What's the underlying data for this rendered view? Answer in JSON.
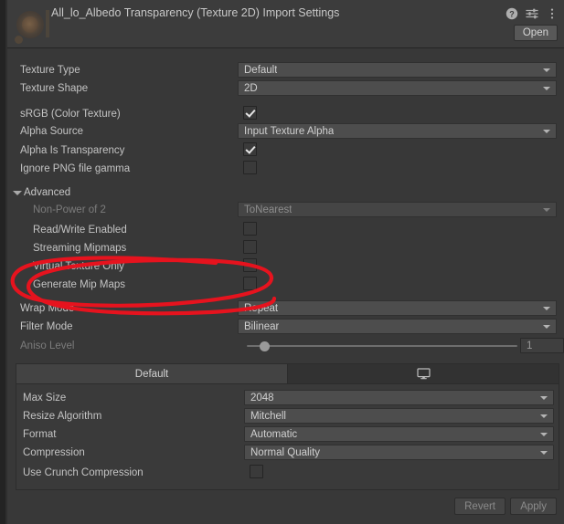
{
  "header": {
    "title": "All_lo_Albedo Transparency (Texture 2D) Import Settings",
    "open_label": "Open",
    "icons": {
      "help": "help-icon",
      "preset": "preset-settings-icon",
      "menu": "more-menu-icon"
    },
    "thumbnail": "texture-thumbnail"
  },
  "main_rows": [
    {
      "label": "Texture Type",
      "type": "dropdown",
      "value": "Default",
      "disabled": false
    },
    {
      "label": "Texture Shape",
      "type": "dropdown",
      "value": "2D",
      "disabled": false
    },
    {
      "label": "sRGB (Color Texture)",
      "type": "checkbox",
      "checked": true,
      "disabled": false
    },
    {
      "label": "Alpha Source",
      "type": "dropdown",
      "value": "Input Texture Alpha",
      "disabled": false
    },
    {
      "label": "Alpha Is Transparency",
      "type": "checkbox",
      "checked": true,
      "disabled": false
    },
    {
      "label": "Ignore PNG file gamma",
      "type": "checkbox",
      "checked": false,
      "disabled": false
    }
  ],
  "advanced": {
    "label": "Advanced",
    "expanded": true,
    "rows": [
      {
        "label": "Non-Power of 2",
        "type": "dropdown",
        "value": "ToNearest",
        "disabled": true
      },
      {
        "label": "Read/Write Enabled",
        "type": "checkbox",
        "checked": false,
        "disabled": false
      },
      {
        "label": "Streaming Mipmaps",
        "type": "checkbox",
        "checked": false,
        "disabled": false
      },
      {
        "label": "Virtual Texture Only",
        "type": "checkbox",
        "checked": false,
        "disabled": false
      },
      {
        "label": "Generate Mip Maps",
        "type": "checkbox",
        "checked": false,
        "disabled": false
      }
    ]
  },
  "sampling_rows": [
    {
      "label": "Wrap Mode",
      "type": "dropdown",
      "value": "Repeat",
      "disabled": false
    },
    {
      "label": "Filter Mode",
      "type": "dropdown",
      "value": "Bilinear",
      "disabled": false
    }
  ],
  "aniso": {
    "label": "Aniso Level",
    "value": "1",
    "disabled": true,
    "slider_position_pct": 5
  },
  "platform": {
    "tabs": [
      {
        "label": "Default",
        "icon": null,
        "active": true
      },
      {
        "label": "",
        "icon": "standalone-monitor-icon",
        "active": false
      }
    ],
    "rows": [
      {
        "label": "Max Size",
        "type": "dropdown",
        "value": "2048"
      },
      {
        "label": "Resize Algorithm",
        "type": "dropdown",
        "value": "Mitchell"
      },
      {
        "label": "Format",
        "type": "dropdown",
        "value": "Automatic"
      },
      {
        "label": "Compression",
        "type": "dropdown",
        "value": "Normal Quality"
      },
      {
        "label": "Use Crunch Compression",
        "type": "checkbox",
        "checked": false
      }
    ]
  },
  "footer": {
    "revert_label": "Revert",
    "apply_label": "Apply"
  },
  "annotation": {
    "kind": "hand-drawn-red-ellipse",
    "target_label": "Generate Mip Maps",
    "color": "#e6131e"
  }
}
